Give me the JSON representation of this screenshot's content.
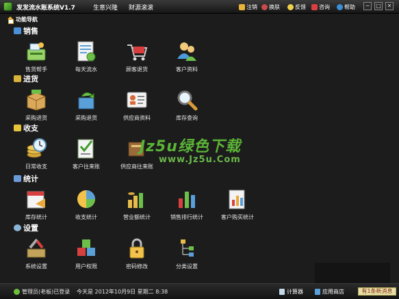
{
  "titlebar": {
    "title": "发发流水账系统V1.7",
    "slogan_a": "生意兴隆",
    "slogan_b": "财源滚滚",
    "links": [
      {
        "label": "注销",
        "icon": "lock-icon"
      },
      {
        "label": "换肤",
        "icon": "skin-icon"
      },
      {
        "label": "反馈",
        "icon": "feedback-icon"
      },
      {
        "label": "咨询",
        "icon": "consult-icon"
      },
      {
        "label": "帮助",
        "icon": "help-icon"
      }
    ],
    "window_buttons": {
      "minimize": "─",
      "maximize": "□",
      "close": "✕"
    }
  },
  "nav": {
    "title": "功能导航",
    "sections": [
      {
        "label": "销售",
        "items": [
          {
            "label": "售货帮手",
            "icon": "cash-register-icon"
          },
          {
            "label": "每天流水",
            "icon": "daily-ledger-icon"
          },
          {
            "label": "顾客退货",
            "icon": "shopping-cart-icon"
          },
          {
            "label": "客户资料",
            "icon": "customers-icon"
          }
        ]
      },
      {
        "label": "进货",
        "items": [
          {
            "label": "采购进货",
            "icon": "purchase-box-icon"
          },
          {
            "label": "采购退货",
            "icon": "purchase-return-icon"
          },
          {
            "label": "供应商资料",
            "icon": "supplier-card-icon"
          },
          {
            "label": "库存查询",
            "icon": "magnifier-icon"
          }
        ]
      },
      {
        "label": "收支",
        "items": [
          {
            "label": "日常收支",
            "icon": "coins-icon"
          },
          {
            "label": "客户往来账",
            "icon": "customer-account-icon"
          },
          {
            "label": "供应商往来账",
            "icon": "supplier-account-icon"
          }
        ]
      },
      {
        "label": "统计",
        "items": [
          {
            "label": "库存统计",
            "icon": "calendar-stock-icon"
          },
          {
            "label": "收支统计",
            "icon": "pie-chart-icon"
          },
          {
            "label": "营业额统计",
            "icon": "turnover-chart-icon"
          },
          {
            "label": "销售排行统计",
            "icon": "bar-chart-icon"
          },
          {
            "label": "客户购买统计",
            "icon": "customer-report-icon"
          }
        ]
      },
      {
        "label": "设置",
        "items": [
          {
            "label": "系统设置",
            "icon": "tools-icon"
          },
          {
            "label": "用户权限",
            "icon": "blocks-icon"
          },
          {
            "label": "密码修改",
            "icon": "padlock-icon"
          },
          {
            "label": "分类设置",
            "icon": "tree-icon"
          }
        ]
      }
    ]
  },
  "watermark": {
    "text": "Jz5u绿色下载",
    "url": "www.Jz5u.Com"
  },
  "status": {
    "user": "管理员(老板)已登录",
    "today_label": "今天是",
    "date": "2012年10月9日",
    "weekday": "星期二",
    "time": "8:38",
    "calculator": "计算器",
    "app_store": "应用商店",
    "messages": "有1条新消息"
  },
  "colors": {
    "background": "#1c1c1c",
    "watermark": "#5bb437",
    "message_bg": "#e6e1a6"
  }
}
